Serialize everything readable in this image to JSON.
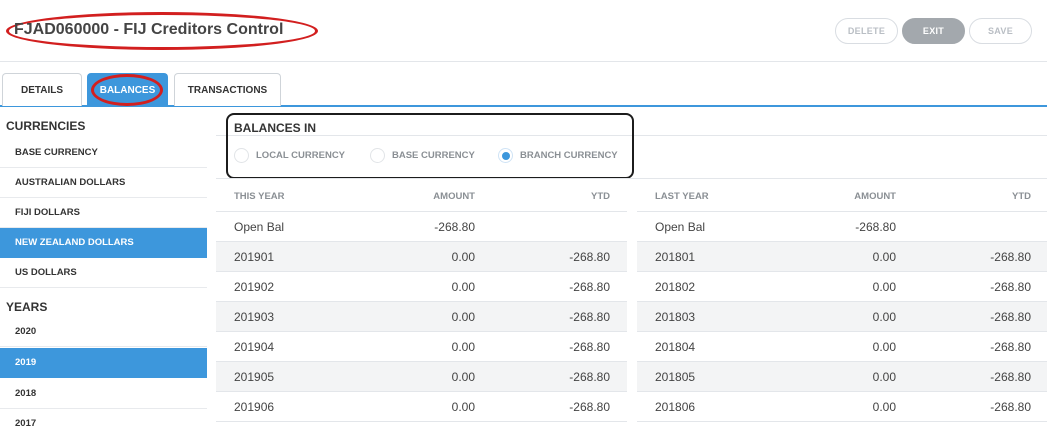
{
  "header": {
    "title": "FJAD060000 - FIJ Creditors Control",
    "buttons": {
      "delete": "DELETE",
      "exit": "EXIT",
      "save": "SAVE"
    }
  },
  "tabs": [
    {
      "label": "DETAILS",
      "active": false
    },
    {
      "label": "BALANCES",
      "active": true
    },
    {
      "label": "TRANSACTIONS",
      "active": false
    }
  ],
  "sidebar": {
    "currencies_heading": "CURRENCIES",
    "currencies": [
      {
        "label": "BASE CURRENCY",
        "active": false
      },
      {
        "label": "AUSTRALIAN DOLLARS",
        "active": false
      },
      {
        "label": "FIJI DOLLARS",
        "active": false
      },
      {
        "label": "NEW ZEALAND DOLLARS",
        "active": true
      },
      {
        "label": "US DOLLARS",
        "active": false
      }
    ],
    "years_heading": "YEARS",
    "years": [
      {
        "label": "2020",
        "active": false
      },
      {
        "label": "2019",
        "active": true
      },
      {
        "label": "2018",
        "active": false
      },
      {
        "label": "2017",
        "active": false
      }
    ]
  },
  "balances_in": {
    "title": "BALANCES IN",
    "options": [
      {
        "label": "LOCAL CURRENCY",
        "selected": false
      },
      {
        "label": "BASE CURRENCY",
        "selected": false
      },
      {
        "label": "BRANCH CURRENCY",
        "selected": true
      }
    ]
  },
  "this_year": {
    "headers": [
      "THIS YEAR",
      "AMOUNT",
      "YTD"
    ],
    "rows": [
      [
        "Open Bal",
        "-268.80",
        ""
      ],
      [
        "201901",
        "0.00",
        "-268.80"
      ],
      [
        "201902",
        "0.00",
        "-268.80"
      ],
      [
        "201903",
        "0.00",
        "-268.80"
      ],
      [
        "201904",
        "0.00",
        "-268.80"
      ],
      [
        "201905",
        "0.00",
        "-268.80"
      ],
      [
        "201906",
        "0.00",
        "-268.80"
      ]
    ]
  },
  "last_year": {
    "headers": [
      "LAST YEAR",
      "AMOUNT",
      "YTD"
    ],
    "rows": [
      [
        "Open Bal",
        "-268.80",
        ""
      ],
      [
        "201801",
        "0.00",
        "-268.80"
      ],
      [
        "201802",
        "0.00",
        "-268.80"
      ],
      [
        "201803",
        "0.00",
        "-268.80"
      ],
      [
        "201804",
        "0.00",
        "-268.80"
      ],
      [
        "201805",
        "0.00",
        "-268.80"
      ],
      [
        "201806",
        "0.00",
        "-268.80"
      ]
    ]
  },
  "colors": {
    "accent": "#3d97dc",
    "annotation": "#d21f1f"
  }
}
